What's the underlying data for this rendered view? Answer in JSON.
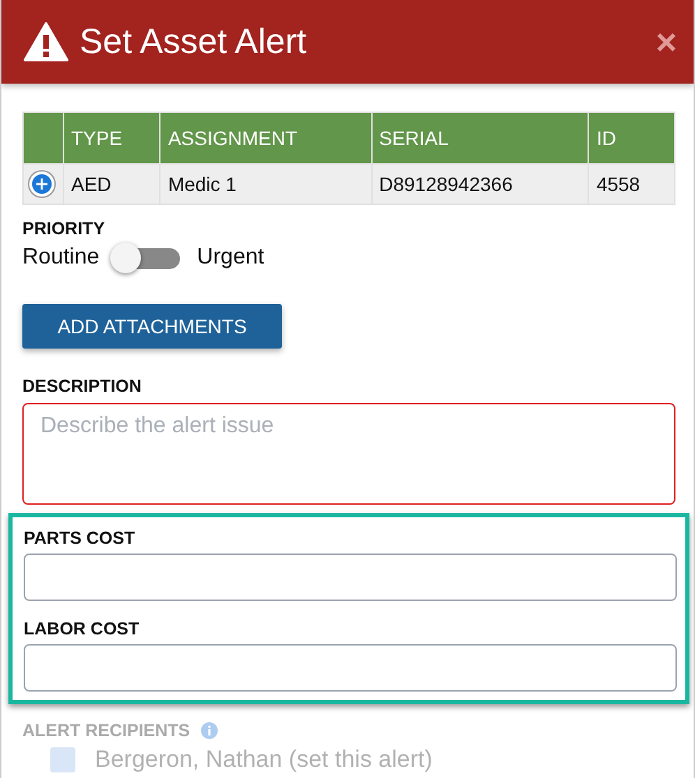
{
  "header": {
    "title": "Set Asset Alert",
    "close": "×"
  },
  "table": {
    "columns": [
      "TYPE",
      "ASSIGNMENT",
      "SERIAL",
      "ID"
    ],
    "rows": [
      {
        "expanded": false,
        "cells": [
          "AED",
          "Medic 1",
          "D89128942366",
          "4558"
        ]
      }
    ]
  },
  "priority": {
    "label": "PRIORITY",
    "off_label": "Routine",
    "on_label": "Urgent",
    "on": false
  },
  "attach_button": "ADD ATTACHMENTS",
  "description": {
    "label": "DESCRIPTION",
    "placeholder": "Describe the alert issue",
    "invalid": true
  },
  "cost_fields": [
    {
      "label": "PARTS COST"
    },
    {
      "label": "LABOR COST"
    }
  ],
  "recipients": {
    "label": "ALERT RECIPIENTS",
    "items": [
      {
        "name": "Bergeron, Nathan (set this alert)",
        "checked": true
      }
    ]
  }
}
